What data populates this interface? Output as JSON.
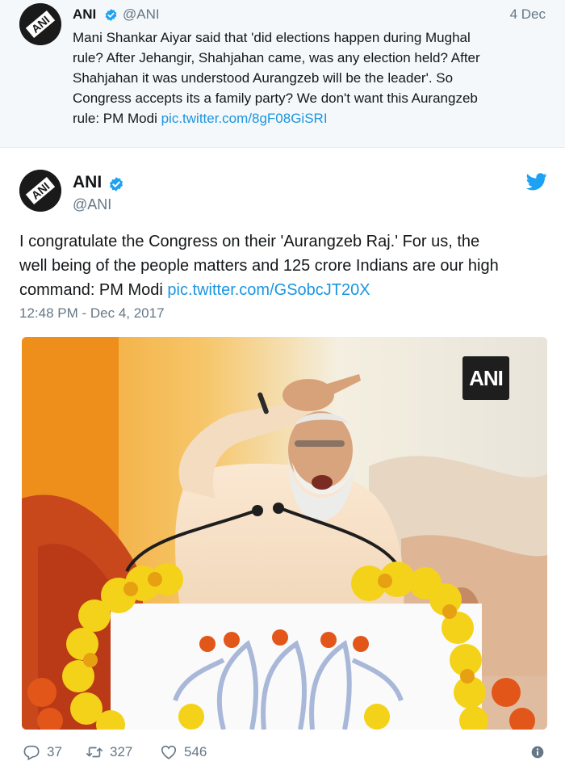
{
  "parent_tweet": {
    "name": "ANI",
    "handle": "@ANI",
    "date": "4 Dec",
    "text": "Mani Shankar Aiyar said that 'did elections happen during Mughal\nrule? After Jehangir, Shahjahan came, was any election held? After\nShahjahan it was understood Aurangzeb will be the leader'. So\nCongress accepts its a family party? We don't want this Aurangzeb\nrule: PM Modi ",
    "link": "pic.twitter.com/8gF08GiSRI"
  },
  "main_tweet": {
    "name": "ANI",
    "handle": "@ANI",
    "text": "I congratulate the Congress on their 'Aurangzeb Raj.' For us, the\nwell being of the people matters and 125 crore Indians are our high\ncommand: PM Modi ",
    "link": "pic.twitter.com/GSobcJT20X",
    "timestamp": "12:48 PM - Dec 4, 2017",
    "photo_watermark": "ANI",
    "replies": "37",
    "retweets": "327",
    "likes": "546"
  },
  "colors": {
    "link": "#1b95e0",
    "secondary_text": "#657786",
    "verified": "#1da1f2",
    "parent_bg": "#f5f8fa"
  },
  "icons": [
    "verified-badge-icon",
    "twitter-bird-icon",
    "reply-icon",
    "retweet-icon",
    "like-icon",
    "info-icon"
  ]
}
